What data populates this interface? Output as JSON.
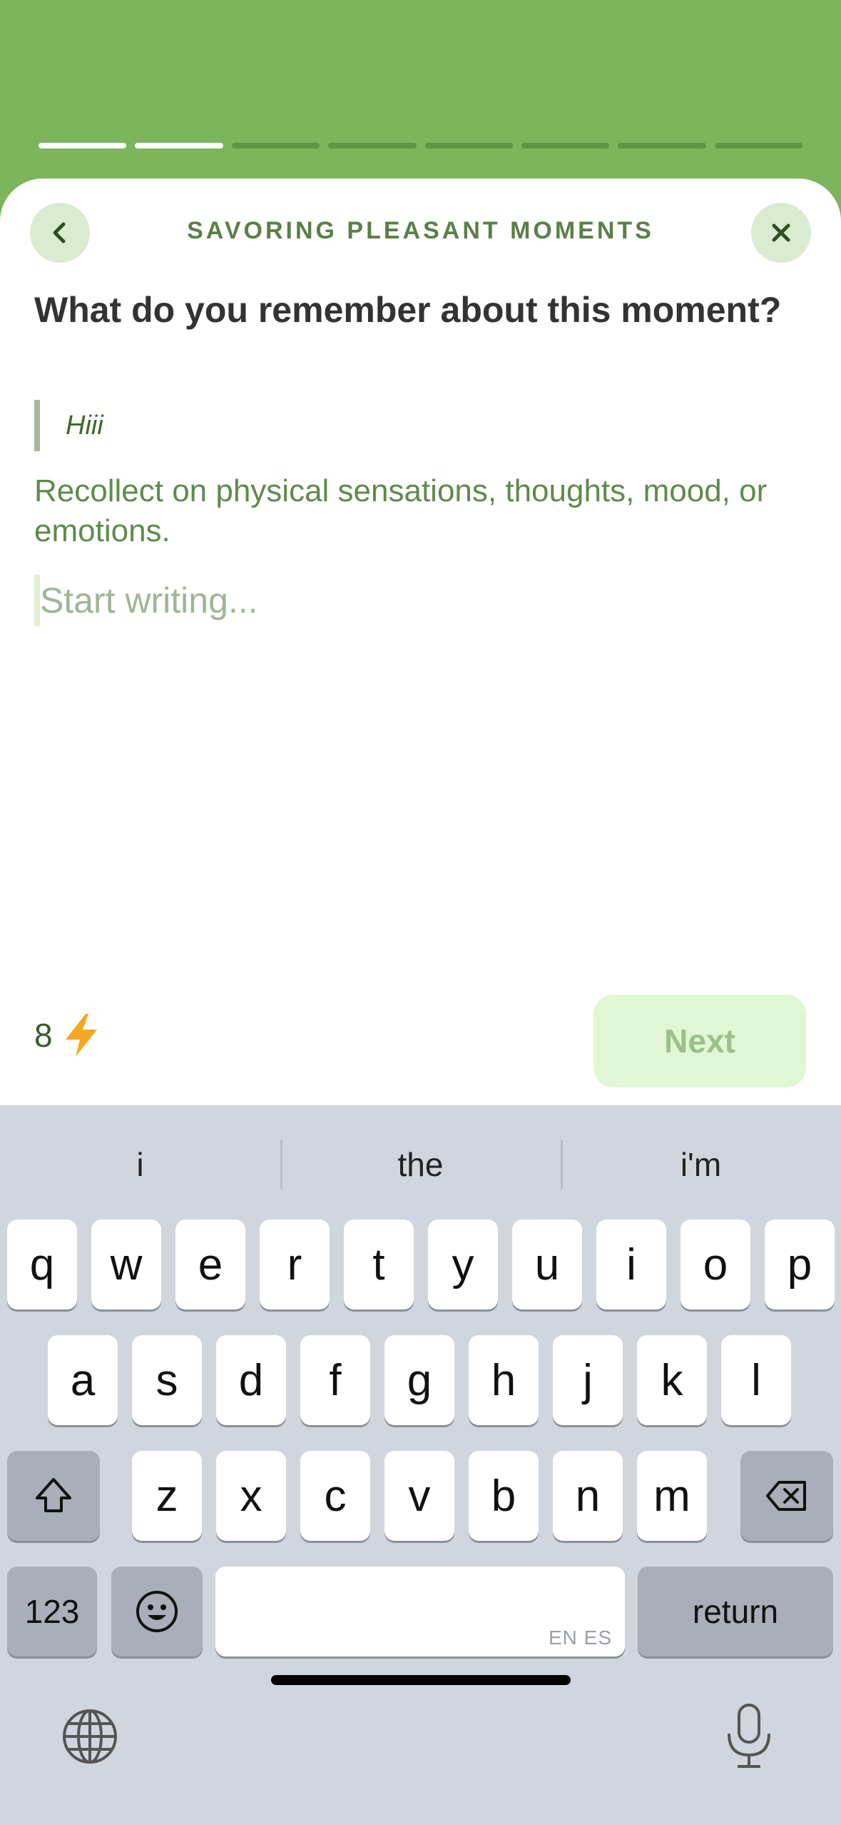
{
  "progress": {
    "total": 8,
    "completed": 2
  },
  "header": {
    "title": "SAVORING PLEASANT MOMENTS"
  },
  "main": {
    "question": "What do you remember about this moment?",
    "quote": "Hiii",
    "hint": "Recollect on physical sensations, thoughts, mood, or emotions.",
    "editor_placeholder": "Start writing...",
    "editor_value": ""
  },
  "footer": {
    "points": "8",
    "next_label": "Next"
  },
  "keyboard": {
    "suggestions": [
      "i",
      "the",
      "i'm"
    ],
    "row1": [
      "q",
      "w",
      "e",
      "r",
      "t",
      "y",
      "u",
      "i",
      "o",
      "p"
    ],
    "row2": [
      "a",
      "s",
      "d",
      "f",
      "g",
      "h",
      "j",
      "k",
      "l"
    ],
    "row3": [
      "z",
      "x",
      "c",
      "v",
      "b",
      "n",
      "m"
    ],
    "numbers_label": "123",
    "return_label": "return",
    "space_tag": "EN ES"
  },
  "colors": {
    "brand_green": "#7cb55c",
    "next_bg": "#dff7d2",
    "bolt": "#f5a623"
  }
}
